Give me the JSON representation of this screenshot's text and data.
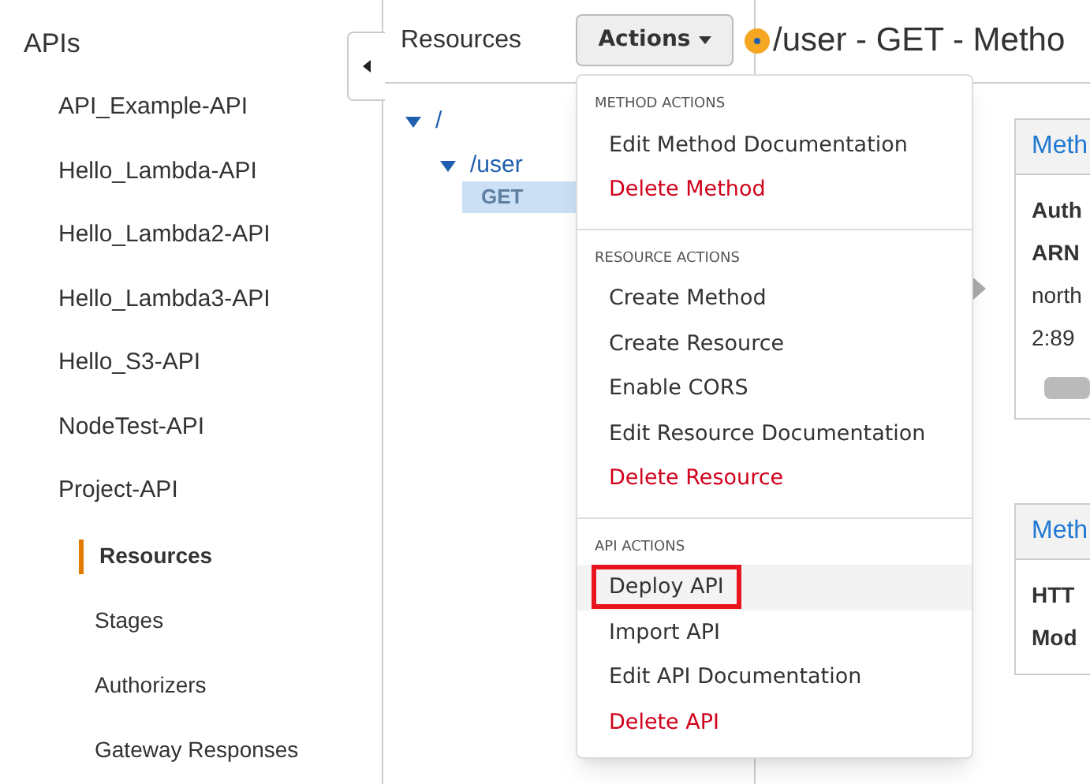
{
  "sidebar": {
    "title": "APIs",
    "apis": [
      {
        "label": "API_Example-API"
      },
      {
        "label": "Hello_Lambda-API"
      },
      {
        "label": "Hello_Lambda2-API"
      },
      {
        "label": "Hello_Lambda3-API"
      },
      {
        "label": "Hello_S3-API"
      },
      {
        "label": "NodeTest-API"
      },
      {
        "label": "Project-API",
        "children": [
          {
            "label": "Resources",
            "selected": true
          },
          {
            "label": "Stages",
            "selected": false
          },
          {
            "label": "Authorizers",
            "selected": false
          },
          {
            "label": "Gateway Responses",
            "selected": false
          }
        ]
      }
    ]
  },
  "resources": {
    "title": "Resources",
    "actions_button": "Actions",
    "tree": [
      {
        "label": "/",
        "expanded": true,
        "children": [
          {
            "label": "/user",
            "expanded": true,
            "methods": [
              {
                "label": "GET",
                "selected": true
              }
            ]
          }
        ]
      }
    ]
  },
  "actions_menu": [
    {
      "heading": "METHOD ACTIONS",
      "items": [
        {
          "label": "Edit Method Documentation",
          "danger": false,
          "highlighted": false
        },
        {
          "label": "Delete Method",
          "danger": true,
          "highlighted": false
        }
      ]
    },
    {
      "heading": "RESOURCE ACTIONS",
      "items": [
        {
          "label": "Create Method",
          "danger": false,
          "highlighted": false
        },
        {
          "label": "Create Resource",
          "danger": false,
          "highlighted": false
        },
        {
          "label": "Enable CORS",
          "danger": false,
          "highlighted": false
        },
        {
          "label": "Edit Resource Documentation",
          "danger": false,
          "highlighted": false
        },
        {
          "label": "Delete Resource",
          "danger": true,
          "highlighted": false
        }
      ]
    },
    {
      "heading": "API ACTIONS",
      "items": [
        {
          "label": "Deploy API",
          "danger": false,
          "highlighted": true
        },
        {
          "label": "Import API",
          "danger": false,
          "highlighted": false
        },
        {
          "label": "Edit API Documentation",
          "danger": false,
          "highlighted": false
        },
        {
          "label": "Delete API",
          "danger": true,
          "highlighted": false
        }
      ]
    }
  ],
  "method": {
    "title": "/user - GET - Metho",
    "boxes": [
      {
        "title": "Meth",
        "lines": [
          {
            "text": "Auth",
            "bold": true
          },
          {
            "text": "ARN",
            "bold": true
          },
          {
            "text": "north",
            "bold": false
          },
          {
            "text": "2:89",
            "bold": false
          }
        ]
      },
      {
        "title": "Meth",
        "lines": [
          {
            "text": "HTT",
            "bold": true
          },
          {
            "text": "Mod",
            "bold": true
          }
        ]
      }
    ]
  }
}
